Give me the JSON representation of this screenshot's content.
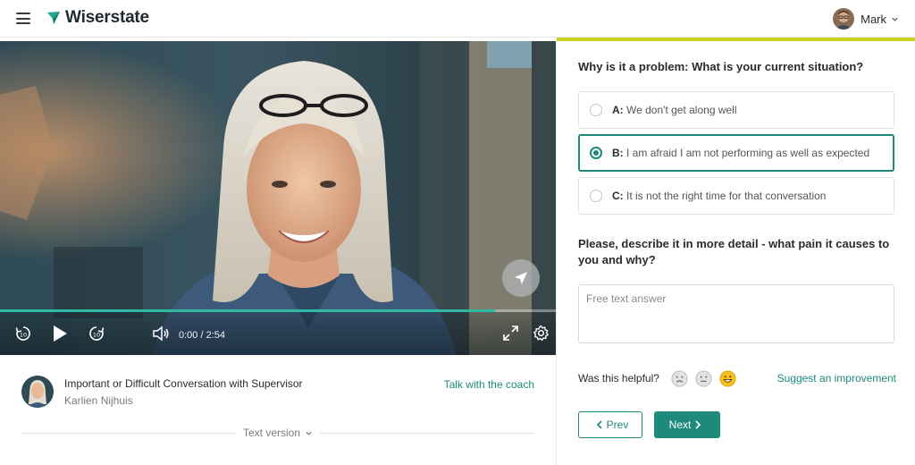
{
  "header": {
    "brand": "Wiserstate",
    "user_name": "Mark"
  },
  "player": {
    "time": "0:00 / 2:54",
    "progress": 0.89
  },
  "lesson": {
    "title": "Important or Difficult Conversation with Supervisor",
    "author": "Karlien Nijhuis",
    "coach_link": "Talk with the coach",
    "text_version": "Text version"
  },
  "quiz": {
    "question1": "Why is it a problem: What is your current situation?",
    "options": [
      {
        "key": "A:",
        "text": "We don't get along well",
        "selected": false
      },
      {
        "key": "B:",
        "text": "I am afraid I am not performing as well as expected",
        "selected": true
      },
      {
        "key": "C:",
        "text": "It is not the right time for that conversation",
        "selected": false
      }
    ],
    "question2": "Please, describe it in more detail - what pain it causes to you and why?",
    "answer_placeholder": "Free text answer"
  },
  "feedback": {
    "label": "Was this helpful?",
    "suggest": "Suggest an improvement"
  },
  "nav": {
    "prev": "Prev",
    "next": "Next"
  },
  "colors": {
    "accent_teal": "#1e8a7a",
    "progress_teal": "#2fb9a5",
    "accent_yellow": "#cdd41f"
  },
  "icons": [
    "menu-icon",
    "logo-icon",
    "chevron-down-icon",
    "send-icon",
    "rewind-10-icon",
    "play-icon",
    "forward-10-icon",
    "volume-icon",
    "fullscreen-icon",
    "settings-icon",
    "sad-face-icon",
    "neutral-face-icon",
    "happy-face-icon",
    "chevron-left-icon",
    "chevron-right-icon"
  ]
}
